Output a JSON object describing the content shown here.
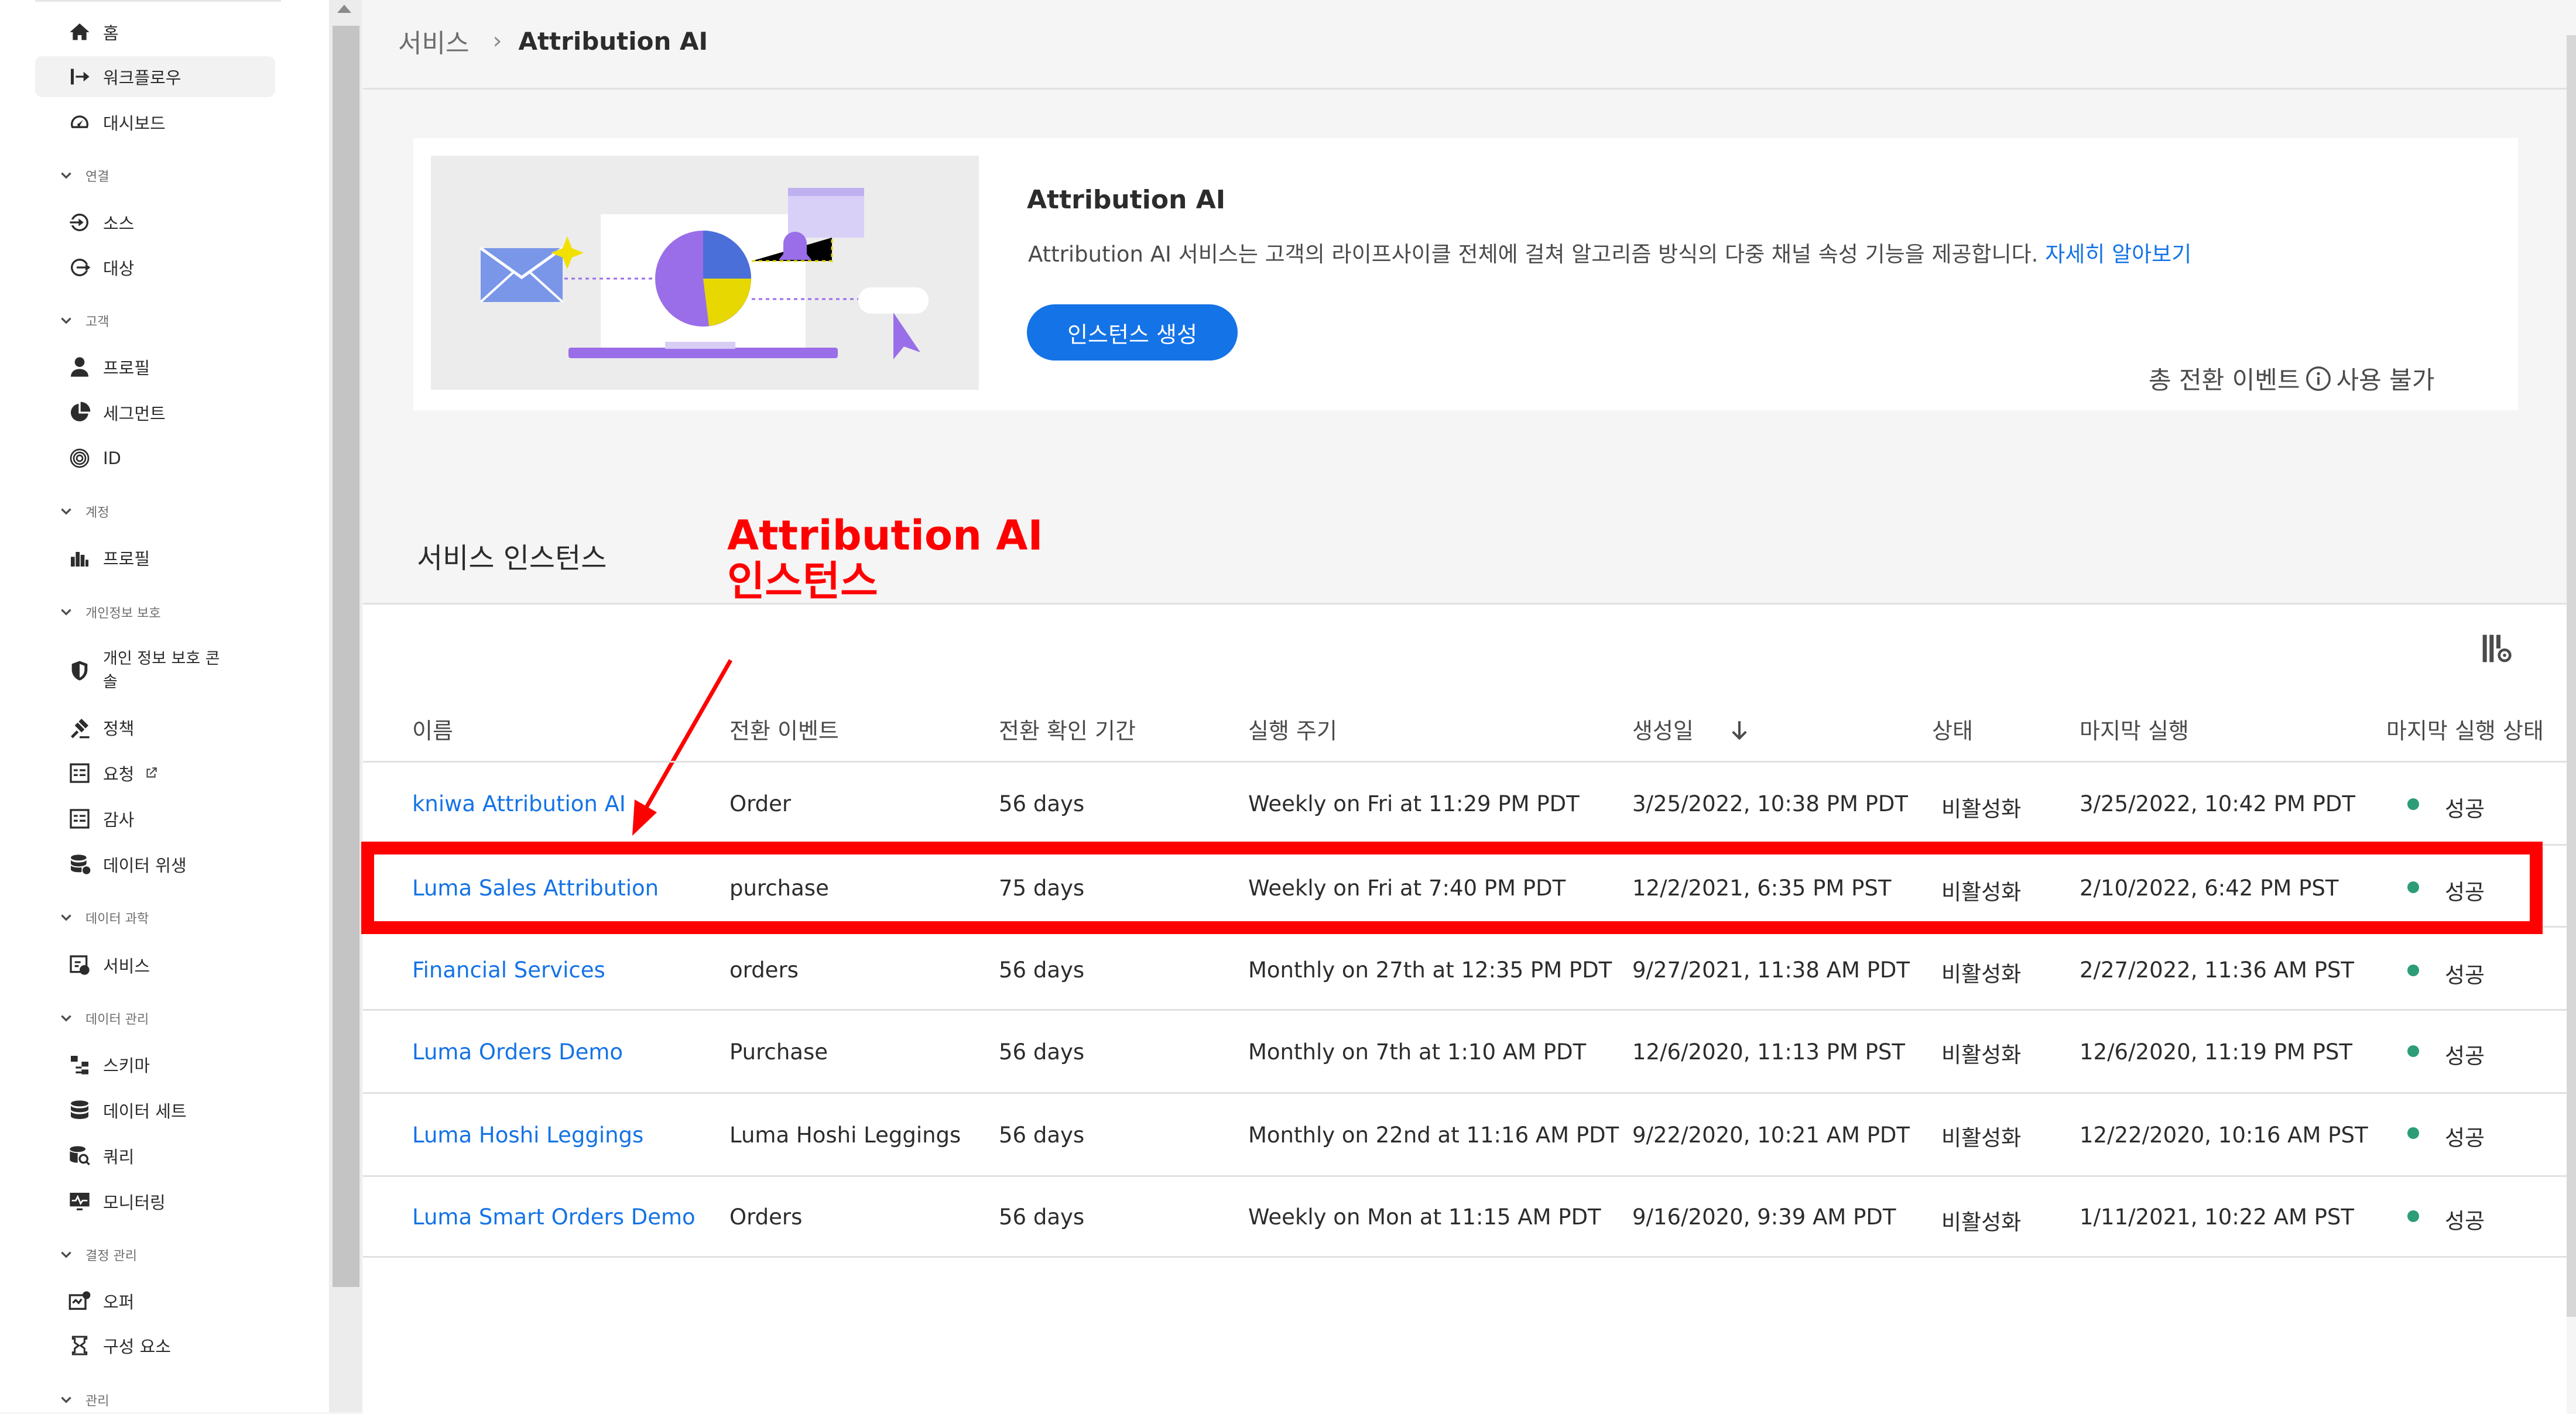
{
  "sidebar": {
    "items": [
      {
        "label": "홈",
        "icon": "home-icon"
      },
      {
        "label": "워크플로우",
        "icon": "workflow-icon"
      },
      {
        "label": "대시보드",
        "icon": "dashboard-icon"
      },
      {
        "label": "소스",
        "icon": "source-icon"
      },
      {
        "label": "대상",
        "icon": "destination-icon"
      },
      {
        "label": "프로필",
        "icon": "profile-icon"
      },
      {
        "label": "세그먼트",
        "icon": "segment-icon"
      },
      {
        "label": "ID",
        "icon": "fingerprint-icon"
      },
      {
        "label": "프로필",
        "icon": "account-profile-icon"
      },
      {
        "label": "개인 정보 보호 콘솔",
        "icon": "privacy-shield-icon"
      },
      {
        "label": "정책",
        "icon": "policy-icon"
      },
      {
        "label": "요청",
        "icon": "request-icon"
      },
      {
        "label": "감사",
        "icon": "audit-icon"
      },
      {
        "label": "데이터 위생",
        "icon": "data-hygiene-icon"
      },
      {
        "label": "서비스",
        "icon": "services-icon"
      },
      {
        "label": "스키마",
        "icon": "schema-icon"
      },
      {
        "label": "데이터 세트",
        "icon": "dataset-icon"
      },
      {
        "label": "쿼리",
        "icon": "query-icon"
      },
      {
        "label": "모니터링",
        "icon": "monitoring-icon"
      },
      {
        "label": "오퍼",
        "icon": "offer-icon"
      },
      {
        "label": "구성 요소",
        "icon": "components-icon"
      }
    ],
    "sections": [
      "연결",
      "고객",
      "계정",
      "개인정보 보호",
      "데이터 과학",
      "데이터 관리",
      "결정 관리",
      "관리"
    ],
    "privacy_console_line1": "개인 정보 보호 콘",
    "privacy_console_line2": "솔"
  },
  "breadcrumb": {
    "parent": "서비스",
    "separator": "›",
    "current": "Attribution AI"
  },
  "card": {
    "title": "Attribution AI",
    "description": "Attribution AI 서비스는 고객의 라이프사이클 전체에 걸쳐 알고리즘 방식의 다중 채널 속성 기능을 제공합니다.",
    "link": "자세히 알아보기",
    "create_button": "인스턴스 생성",
    "conversion_label": "총 전환 이벤트",
    "conversion_value": "사용 불가"
  },
  "instances": {
    "title": "서비스 인스턴스",
    "annotation_line1": "Attribution AI",
    "annotation_line2": "인스턴스",
    "columns": [
      "이름",
      "전환 이벤트",
      "전환 확인 기간",
      "실행 주기",
      "생성일",
      "상태",
      "마지막 실행",
      "마지막 실행 상태"
    ],
    "rows": [
      {
        "name": "kniwa Attribution AI",
        "event": "Order",
        "lookback": "56 days",
        "schedule": "Weekly on Fri at 11:29 PM PDT",
        "created": "3/25/2022, 10:38 PM PDT",
        "status": "비활성화",
        "last_run": "3/25/2022, 10:42 PM PDT",
        "last_status": "성공"
      },
      {
        "name": "Luma Sales Attribution",
        "event": "purchase",
        "lookback": "75 days",
        "schedule": "Weekly on Fri at 7:40 PM PDT",
        "created": "12/2/2021, 6:35 PM PST",
        "status": "비활성화",
        "last_run": "2/10/2022, 6:42 PM PST",
        "last_status": "성공"
      },
      {
        "name": "Financial Services",
        "event": "orders",
        "lookback": "56 days",
        "schedule": "Monthly on 27th at 12:35 PM PDT",
        "created": "9/27/2021, 11:38 AM PDT",
        "status": "비활성화",
        "last_run": "2/27/2022, 11:36 AM PST",
        "last_status": "성공"
      },
      {
        "name": "Luma Orders Demo",
        "event": "Purchase",
        "lookback": "56 days",
        "schedule": "Monthly on 7th at 1:10 AM PDT",
        "created": "12/6/2020, 11:13 PM PST",
        "status": "비활성화",
        "last_run": "12/6/2020, 11:19 PM PST",
        "last_status": "성공"
      },
      {
        "name": "Luma Hoshi Leggings",
        "event": "Luma Hoshi Leggings",
        "lookback": "56 days",
        "schedule": "Monthly on 22nd at 11:16 AM PDT",
        "created": "9/22/2020, 10:21 AM PDT",
        "status": "비활성화",
        "last_run": "12/22/2020, 10:16 AM PST",
        "last_status": "성공"
      },
      {
        "name": "Luma Smart Orders Demo",
        "event": "Orders",
        "lookback": "56 days",
        "schedule": "Weekly on Mon at 11:15 AM PDT",
        "created": "9/16/2020, 9:39 AM PDT",
        "status": "비활성화",
        "last_run": "1/11/2021, 10:22 AM PST",
        "last_status": "성공"
      }
    ]
  },
  "colors": {
    "accent": "#1473e6",
    "annotation": "#ff0000",
    "success": "#2d9d78"
  }
}
